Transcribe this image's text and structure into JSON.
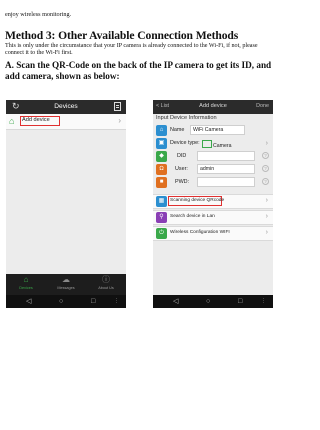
{
  "doc": {
    "intro_tail": "enjoy wireless monitoring.",
    "method_heading": "Method 3: Other Available Connection Methods",
    "method_note": "This is only under the circumstance that your IP camera is already connected to the Wi-Fi, if not, please connect it to the Wi-Fi first.",
    "step_heading": "A. Scan the QR-Code on the back of the IP camera to get its ID, and add camera, shown as below:"
  },
  "phone_left": {
    "header_title": "Devices",
    "list_item": "Add device",
    "tabs": [
      {
        "label": "Devices",
        "icon": "home-icon"
      },
      {
        "label": "Messages",
        "icon": "cloud-icon"
      },
      {
        "label": "About Us",
        "icon": "info-icon"
      }
    ]
  },
  "phone_right": {
    "back_label": "< List",
    "header_title": "Add device",
    "done_label": "Done",
    "section_title": "Input Device Information",
    "fields": [
      {
        "label": "Name",
        "value": "WiFi Camera"
      },
      {
        "label": "Device type:",
        "value": "Camera"
      },
      {
        "label": "DID",
        "value": ""
      },
      {
        "label": "User:",
        "value": "admin"
      },
      {
        "label": "PWD:",
        "value": ""
      }
    ],
    "actions": [
      {
        "label": "Scanning device QRcode"
      },
      {
        "label": "Search device in Lan"
      },
      {
        "label": "Wireless Configuration WIFI"
      }
    ]
  },
  "colors": {
    "accent_green": "#3aa84a",
    "highlight_red": "#e03030",
    "header_dark": "#2b2b2b"
  }
}
